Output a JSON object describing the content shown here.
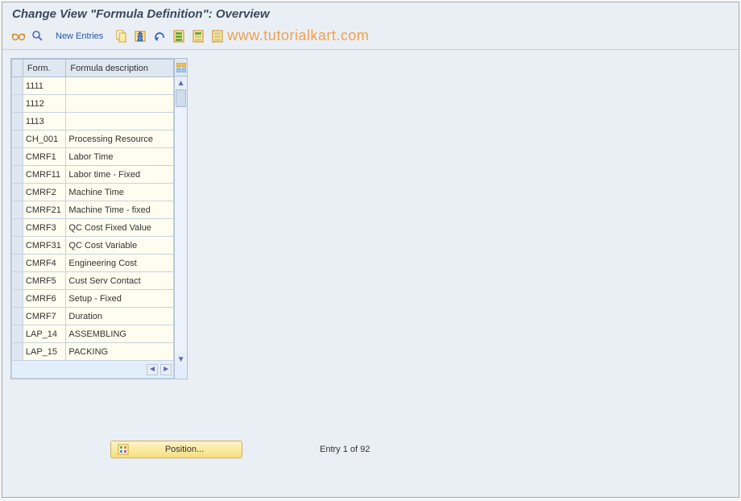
{
  "title": "Change View \"Formula Definition\": Overview",
  "toolbar": {
    "new_entries_label": "New Entries"
  },
  "watermark": "www.tutorialkart.com",
  "table": {
    "headers": {
      "form": "Form.",
      "description": "Formula description"
    },
    "rows": [
      {
        "form": "1111",
        "desc": ""
      },
      {
        "form": "1112",
        "desc": ""
      },
      {
        "form": "1113",
        "desc": ""
      },
      {
        "form": "CH_001",
        "desc": "Processing Resource"
      },
      {
        "form": "CMRF1",
        "desc": "Labor Time"
      },
      {
        "form": "CMRF11",
        "desc": "Labor time - Fixed"
      },
      {
        "form": "CMRF2",
        "desc": "Machine Time"
      },
      {
        "form": "CMRF21",
        "desc": "Machine Time - fixed"
      },
      {
        "form": "CMRF3",
        "desc": "QC Cost Fixed Value"
      },
      {
        "form": "CMRF31",
        "desc": "QC Cost Variable"
      },
      {
        "form": "CMRF4",
        "desc": "Engineering Cost"
      },
      {
        "form": "CMRF5",
        "desc": "Cust Serv Contact"
      },
      {
        "form": "CMRF6",
        "desc": "Setup - Fixed"
      },
      {
        "form": "CMRF7",
        "desc": "Duration"
      },
      {
        "form": "LAP_14",
        "desc": "ASSEMBLING"
      },
      {
        "form": "LAP_15",
        "desc": "PACKING"
      }
    ]
  },
  "position_button": "Position...",
  "entry_status": "Entry 1 of 92"
}
